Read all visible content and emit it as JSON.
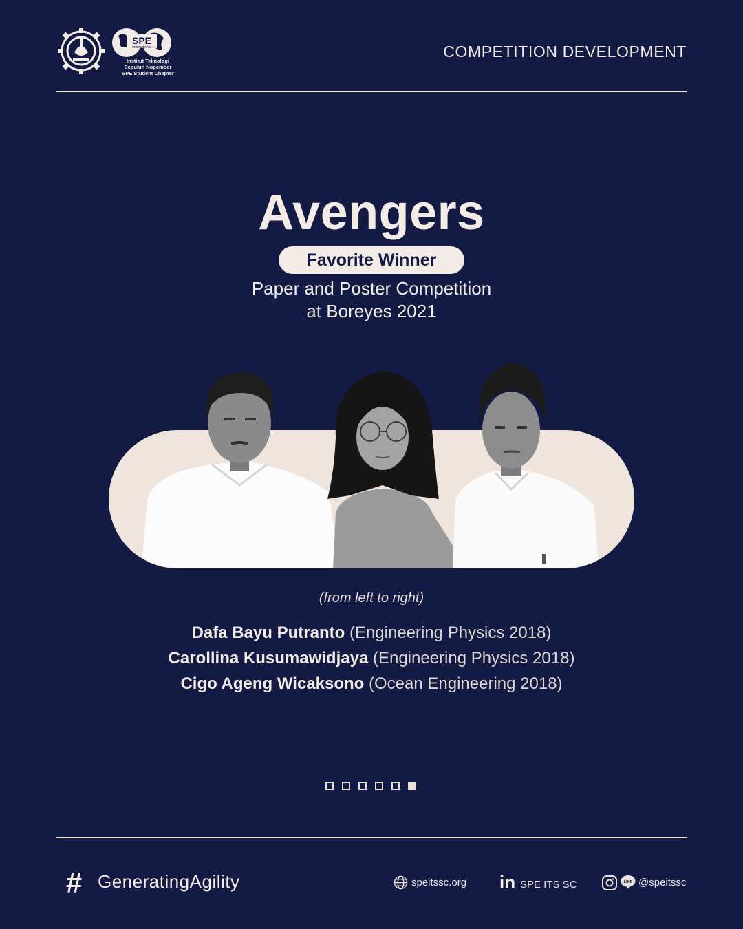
{
  "header": {
    "logo_caption": [
      "Institut Teknologi",
      "Sepuluh Nopember",
      "SPE Student Chapter"
    ],
    "logo_badge": "SPE",
    "logo_badge_sub": "International",
    "section_label": "COMPETITION DEVELOPMENT"
  },
  "main": {
    "team_name": "Avengers",
    "award": "Favorite Winner",
    "competition": "Paper and Poster Competition",
    "event_prefix": "at",
    "event_name": "Boreyes 2021",
    "order_note": "(from left to right)",
    "members": [
      {
        "name": "Dafa Bayu Putranto",
        "dept": "(Engineering Physics 2018)"
      },
      {
        "name": "Carollina Kusumawidjaya",
        "dept": "(Engineering Physics 2018)"
      },
      {
        "name": "Cigo Ageng Wicaksono",
        "dept": "(Ocean Engineering 2018)"
      }
    ]
  },
  "pagination": {
    "total": 6,
    "current": 6
  },
  "footer": {
    "hashtag": "GeneratingAgility",
    "website": "speitssc.org",
    "linkedin": "SPE ITS SC",
    "social": "@speitssc",
    "line_icon_text": "LINE"
  },
  "colors": {
    "background": "#131a44",
    "cream": "#f3ece6",
    "band": "#efe5dc"
  },
  "icons": [
    "its-gear-logo",
    "spe-globe-logo",
    "hashtag-icon",
    "globe-icon",
    "linkedin-icon",
    "instagram-icon",
    "line-icon"
  ]
}
